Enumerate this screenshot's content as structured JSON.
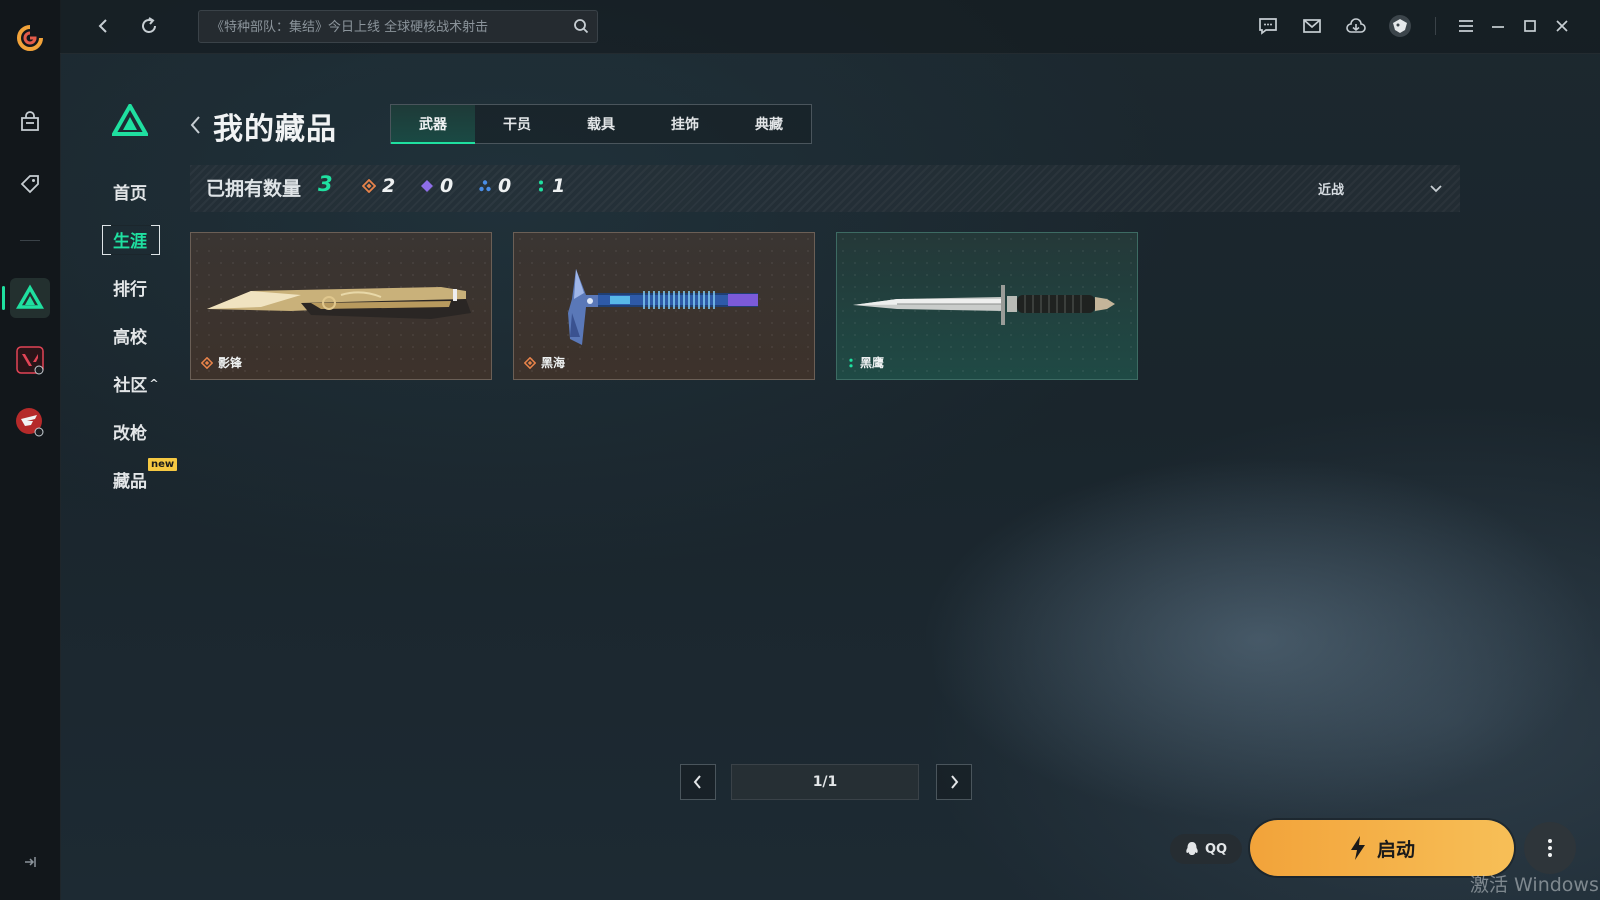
{
  "topbar": {
    "search_placeholder": "《特种部队：集结》今日上线 全球硬核战术射击"
  },
  "subnav": {
    "items": [
      {
        "label": "首页"
      },
      {
        "label": "生涯"
      },
      {
        "label": "排行"
      },
      {
        "label": "高校"
      },
      {
        "label": "社区"
      },
      {
        "label": "改枪"
      },
      {
        "label": "藏品"
      }
    ],
    "community_caret": "^",
    "new_badge": "new"
  },
  "header": {
    "title": "我的藏品",
    "tabs": [
      {
        "label": "武器"
      },
      {
        "label": "干员"
      },
      {
        "label": "载具"
      },
      {
        "label": "挂饰"
      },
      {
        "label": "典藏"
      }
    ]
  },
  "summary": {
    "owned_label": "已拥有数量",
    "owned_count": "3",
    "rarities": [
      {
        "count": "2",
        "color": "#e8834a"
      },
      {
        "count": "0",
        "color": "#8e6ee8"
      },
      {
        "count": "0",
        "color": "#4a8ee8"
      },
      {
        "count": "1",
        "color": "#1fe0a0"
      }
    ],
    "sort_value": "近战"
  },
  "items": [
    {
      "name": "影锋",
      "rarity_color": "#e8834a"
    },
    {
      "name": "黑海",
      "rarity_color": "#e8834a"
    },
    {
      "name": "黑鹰",
      "rarity_color": "#1fe0a0"
    }
  ],
  "pagination": {
    "page": "1/1"
  },
  "footer": {
    "qq_label": "QQ",
    "launch_label": "启动"
  },
  "watermark": "激活 Windows",
  "colors": {
    "accent": "#1fe0a0",
    "launch": "#f2a33a"
  }
}
